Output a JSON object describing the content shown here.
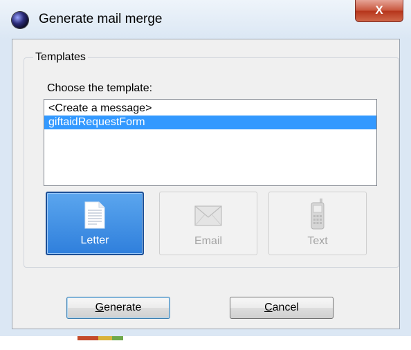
{
  "window": {
    "title": "Generate mail merge",
    "close_glyph": "X"
  },
  "templates": {
    "group_label": "Templates",
    "choose_label": "Choose the template:",
    "list_items": [
      {
        "label": "<Create a message>",
        "selected": false
      },
      {
        "label": "giftaidRequestForm",
        "selected": true
      }
    ]
  },
  "type_buttons": [
    {
      "label": "Letter",
      "icon": "letter-icon",
      "state": "selected"
    },
    {
      "label": "Email",
      "icon": "envelope-icon",
      "state": "disabled"
    },
    {
      "label": "Text",
      "icon": "mobile-phone-icon",
      "state": "disabled"
    }
  ],
  "actions": {
    "generate_hotkey": "G",
    "generate_rest": "enerate",
    "cancel_hotkey": "C",
    "cancel_rest": "ancel"
  },
  "colors": {
    "selection": "#3399ff",
    "active_button": "#3b8ae4",
    "close_button": "#c9583f"
  }
}
